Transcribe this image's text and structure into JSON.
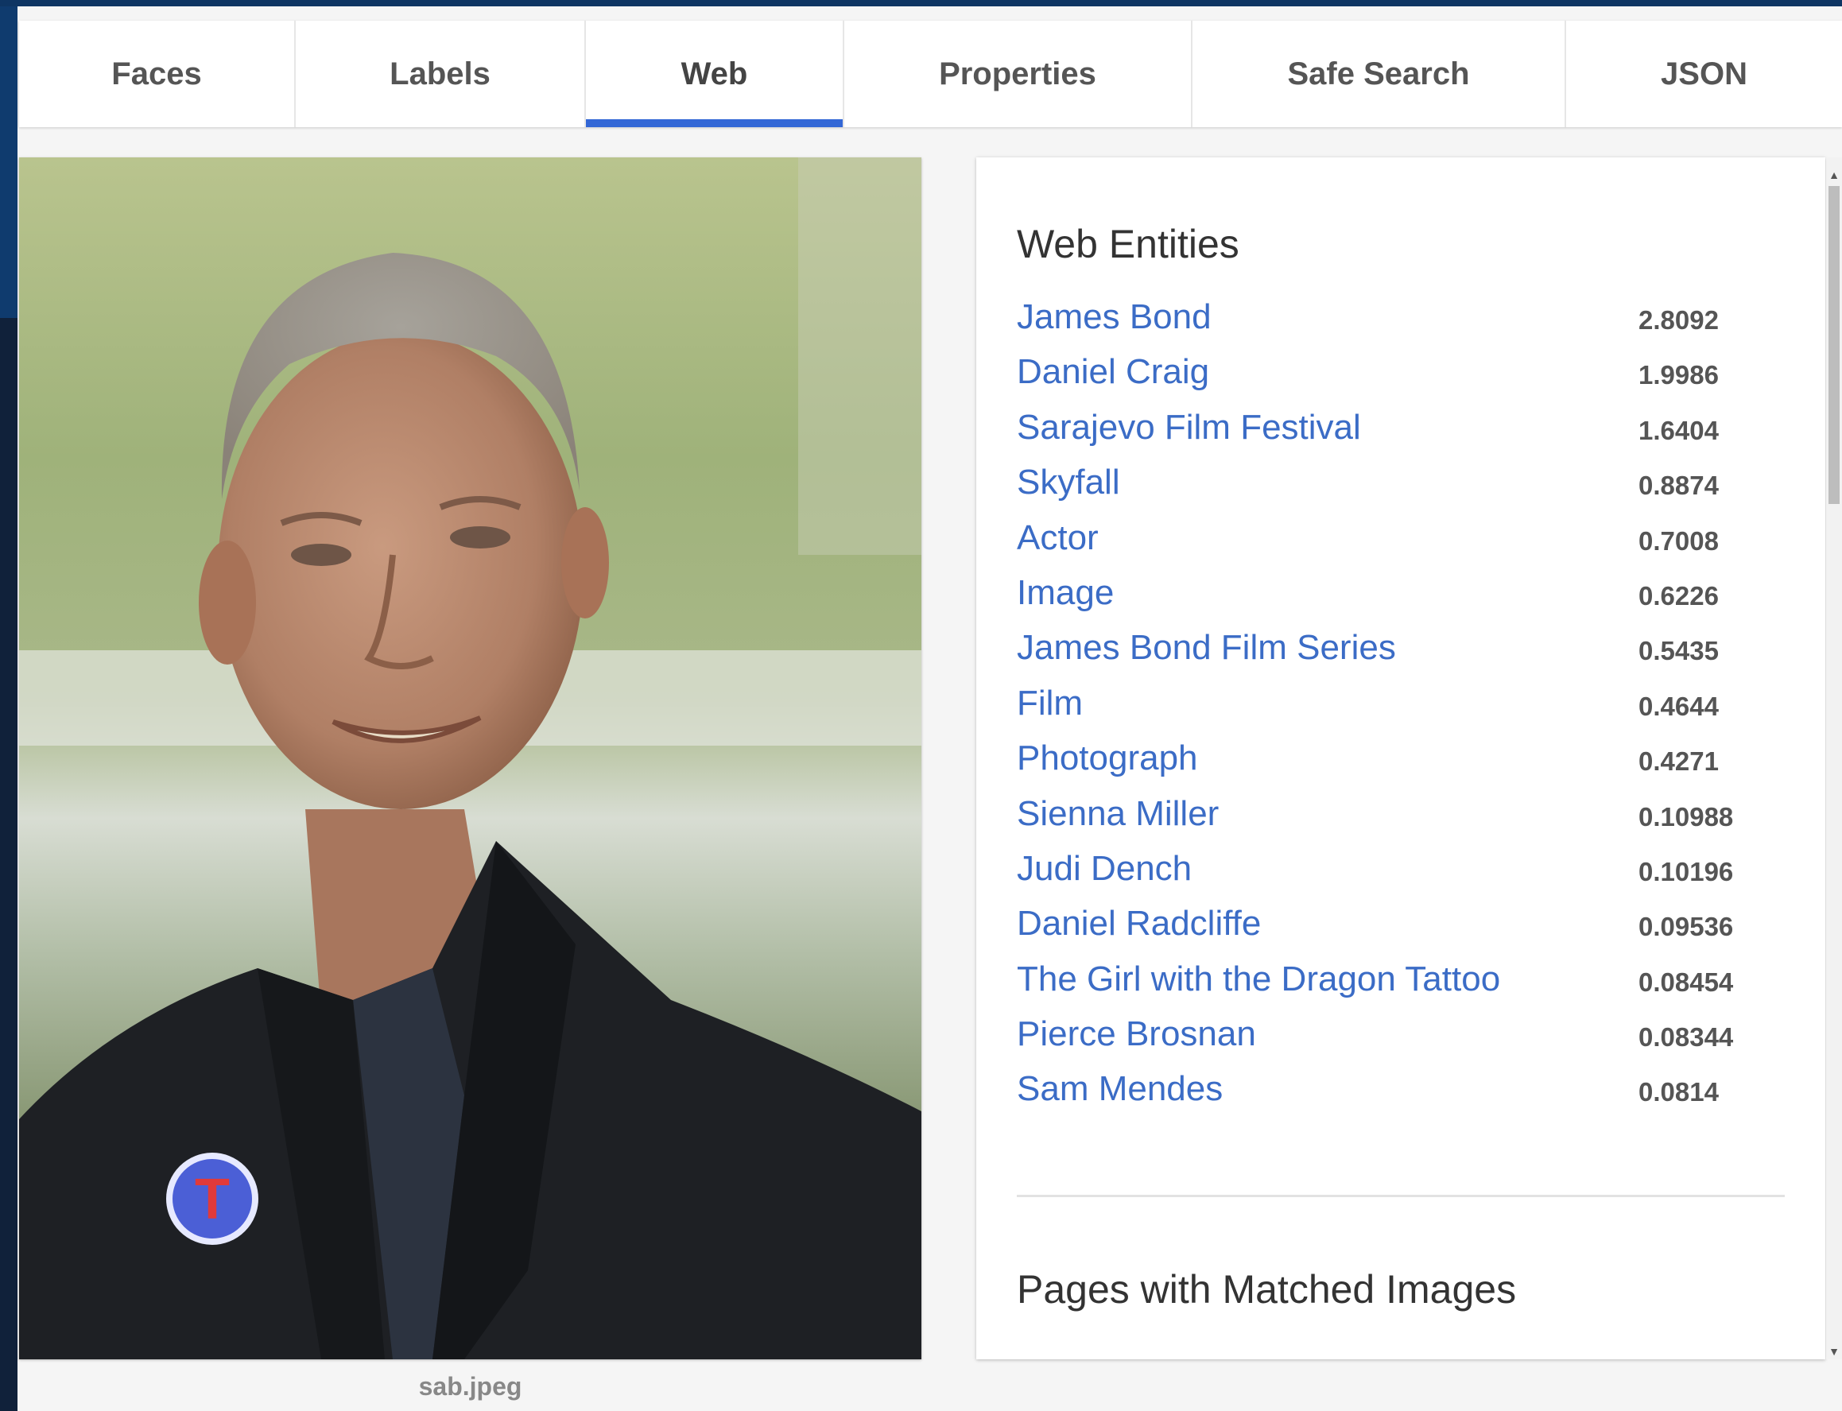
{
  "tabs": [
    {
      "label": "Faces",
      "active": false
    },
    {
      "label": "Labels",
      "active": false
    },
    {
      "label": "Web",
      "active": true
    },
    {
      "label": "Properties",
      "active": false
    },
    {
      "label": "Safe Search",
      "active": false
    },
    {
      "label": "JSON",
      "active": false
    }
  ],
  "image": {
    "caption": "sab.jpeg",
    "badge_letter": "T"
  },
  "web_entities": {
    "title": "Web Entities",
    "items": [
      {
        "name": "James Bond",
        "score": "2.8092"
      },
      {
        "name": "Daniel Craig",
        "score": "1.9986"
      },
      {
        "name": "Sarajevo Film Festival",
        "score": "1.6404"
      },
      {
        "name": "Skyfall",
        "score": "0.8874"
      },
      {
        "name": "Actor",
        "score": "0.7008"
      },
      {
        "name": "Image",
        "score": "0.6226"
      },
      {
        "name": "James Bond Film Series",
        "score": "0.5435"
      },
      {
        "name": "Film",
        "score": "0.4644"
      },
      {
        "name": "Photograph",
        "score": "0.4271"
      },
      {
        "name": "Sienna Miller",
        "score": "0.10988"
      },
      {
        "name": "Judi Dench",
        "score": "0.10196"
      },
      {
        "name": "Daniel Radcliffe",
        "score": "0.09536"
      },
      {
        "name": "The Girl with the Dragon Tattoo",
        "score": "0.08454"
      },
      {
        "name": "Pierce Brosnan",
        "score": "0.08344"
      },
      {
        "name": "Sam Mendes",
        "score": "0.0814"
      }
    ]
  },
  "pages_with_matched_images": {
    "title": "Pages with Matched Images"
  },
  "colors": {
    "accent": "#3367d6",
    "link": "#3b6cc6",
    "frame": "#0f3b6e"
  },
  "icons": {
    "scroll_up": "scroll-up-arrow-icon",
    "scroll_down": "scroll-down-arrow-icon"
  }
}
